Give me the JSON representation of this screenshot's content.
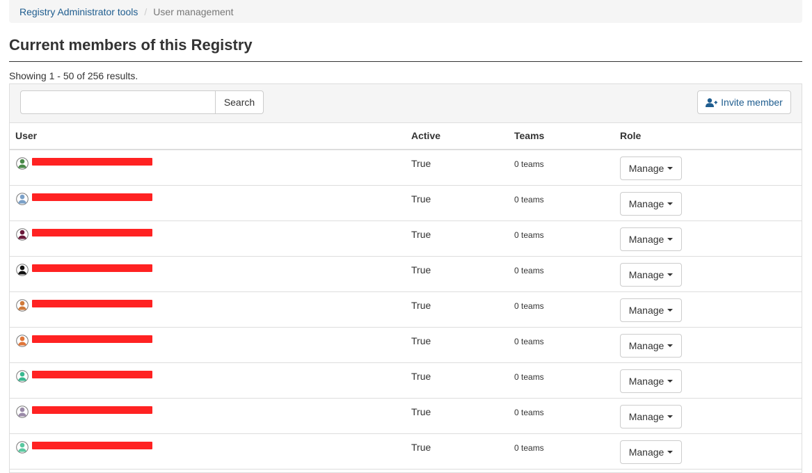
{
  "breadcrumb": {
    "parent": "Registry Administrator tools",
    "current": "User management"
  },
  "page_title": "Current members of this Registry",
  "results_text": "Showing 1 - 50 of 256 results.",
  "toolbar": {
    "search_value": "",
    "search_label": "Search",
    "invite_label": "Invite member",
    "invite_icon": "user-plus-icon"
  },
  "table": {
    "headers": {
      "user": "User",
      "active": "Active",
      "teams": "Teams",
      "role": "Role"
    },
    "rows": [
      {
        "avatar_color": "#4a8a4a",
        "active": "True",
        "teams": "0 teams",
        "role_label": "Manage"
      },
      {
        "avatar_color": "#7aa0c8",
        "active": "True",
        "teams": "0 teams",
        "role_label": "Manage"
      },
      {
        "avatar_color": "#6b1a3a",
        "active": "True",
        "teams": "0 teams",
        "role_label": "Manage"
      },
      {
        "avatar_color": "#111111",
        "active": "True",
        "teams": "0 teams",
        "role_label": "Manage"
      },
      {
        "avatar_color": "#d07a3a",
        "active": "True",
        "teams": "0 teams",
        "role_label": "Manage"
      },
      {
        "avatar_color": "#e0763a",
        "active": "True",
        "teams": "0 teams",
        "role_label": "Manage"
      },
      {
        "avatar_color": "#3ab890",
        "active": "True",
        "teams": "0 teams",
        "role_label": "Manage"
      },
      {
        "avatar_color": "#9a8aa8",
        "active": "True",
        "teams": "0 teams",
        "role_label": "Manage"
      },
      {
        "avatar_color": "#5ac8a0",
        "active": "True",
        "teams": "0 teams",
        "role_label": "Manage"
      }
    ]
  },
  "colors": {
    "link": "#1f5d8f",
    "redaction": "#ff2222"
  }
}
